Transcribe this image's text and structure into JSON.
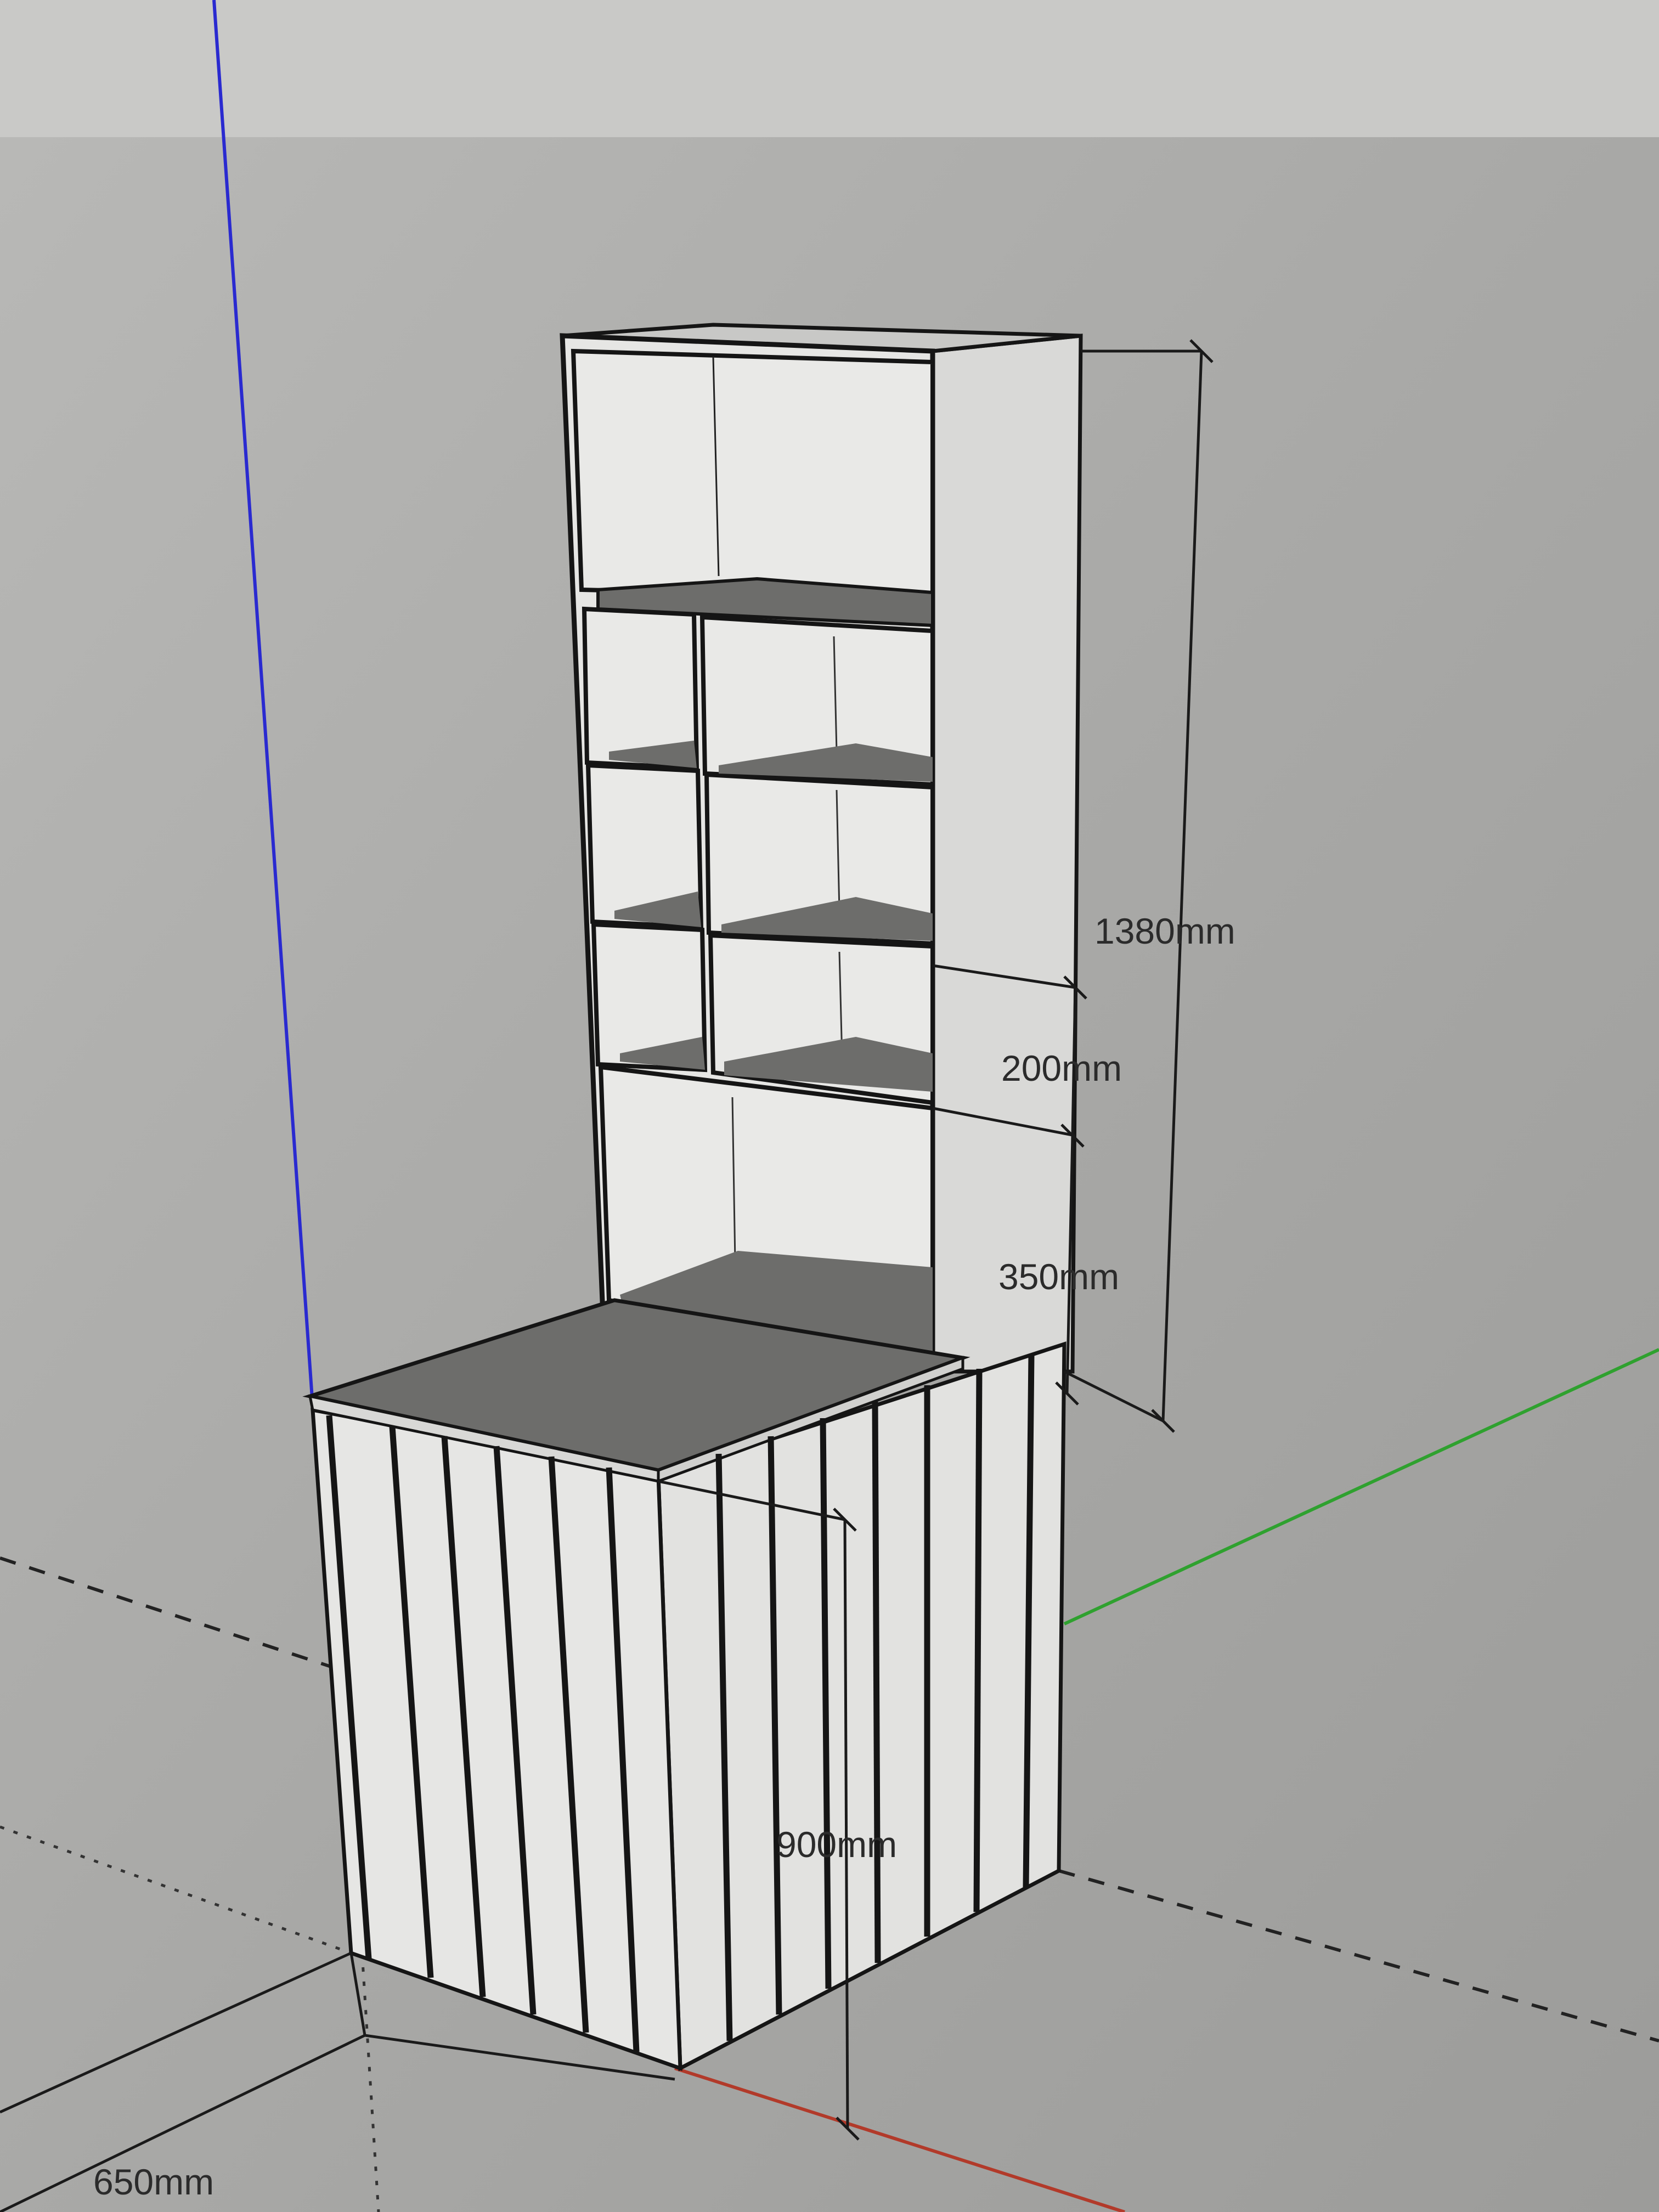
{
  "viewport": {
    "scene": "3D model of tall shelving cabinet on slatted base",
    "axes": {
      "blue": "#2a2ad0",
      "green": "#2fa12f",
      "red": "#b23a2a"
    },
    "colors": {
      "sky": "#bdbdbb",
      "ground": "#a3a3a1",
      "face_light": "#e3e3e1",
      "face_dark": "#6d6d6b",
      "edge": "#151515"
    }
  },
  "dimensions": {
    "total_height": "1380mm",
    "shelf_gap": "200mm",
    "lower_gap": "350mm",
    "base_height": "900mm",
    "base_depth": "650mm"
  }
}
